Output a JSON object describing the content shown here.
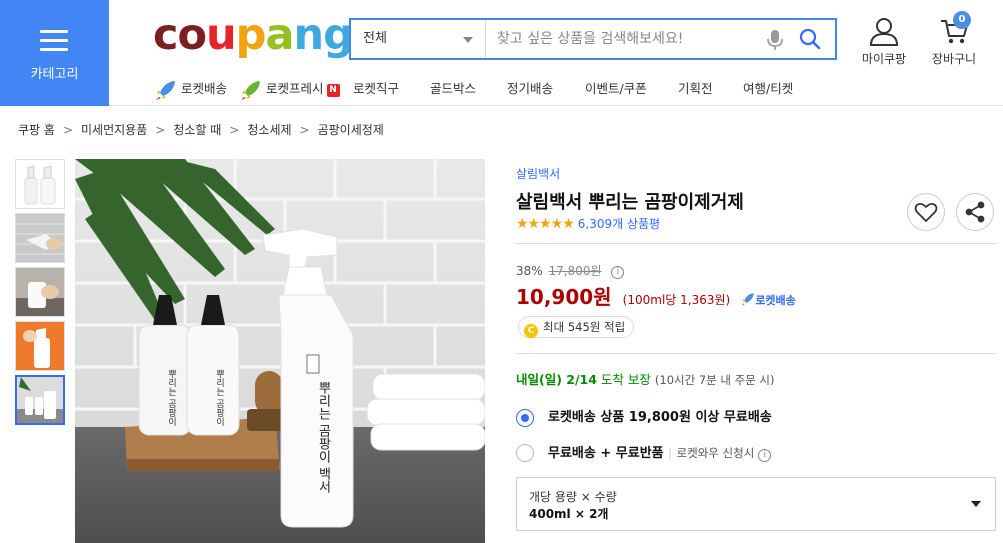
{
  "header": {
    "category_label": "카테고리",
    "logo": [
      {
        "ch": "c",
        "color": "#7b1e1e"
      },
      {
        "ch": "o",
        "color": "#7b1e1e"
      },
      {
        "ch": "u",
        "color": "#e52528"
      },
      {
        "ch": "p",
        "color": "#f2a30f"
      },
      {
        "ch": "a",
        "color": "#94c120"
      },
      {
        "ch": "n",
        "color": "#3fa9dd"
      },
      {
        "ch": "g",
        "color": "#3fa9dd"
      }
    ],
    "search": {
      "category_value": "전체",
      "placeholder": "찾고 싶은 상품을 검색해보세요!"
    },
    "mycoupang_label": "마이쿠팡",
    "cart_label": "장바구니",
    "cart_count": "0"
  },
  "nav": [
    {
      "label": "로켓배송",
      "icon": "rocket-icon"
    },
    {
      "label": "로켓프레시",
      "icon": "rocket-icon",
      "badge": "N"
    },
    {
      "label": "로켓직구"
    },
    {
      "label": "골드박스"
    },
    {
      "label": "정기배송"
    },
    {
      "label": "이벤트/쿠폰"
    },
    {
      "label": "기획전"
    },
    {
      "label": "여행/티켓"
    }
  ],
  "breadcrumb": [
    "쿠팡 홈",
    "미세먼지용품",
    "청소할 때",
    "청소세제",
    "곰팡이세정제"
  ],
  "product": {
    "brand": "살림백서",
    "title": "살림백서 뿌리는 곰팡이제거제",
    "rating": 4.5,
    "stars": "★★★★★",
    "review_count": "6,309개 상품평",
    "discount_rate": "38%",
    "original_price": "17,800원",
    "price": "10,900원",
    "unit_price": "(100ml당 1,363원)",
    "rocket_label": "로켓배송",
    "cash_label": "최대 545원 적립",
    "arrival_day": "내일(일) 2/14",
    "arrival_guarantee": " 도착 보장",
    "arrival_note": "(10시간 7분 내 주문 시)",
    "shipping_options": [
      {
        "label": "로켓배송 상품 19,800원 이상 무료배송",
        "selected": true
      },
      {
        "label": "무료배송 + 무료반품",
        "sub": "로켓와우 신청시",
        "selected": false
      }
    ],
    "option_select": {
      "label": "개당 용량 × 수량",
      "value": "400ml × 2개"
    },
    "bottle_label": "뿌리는 곰팡이 백서",
    "bottle_small_label": "뿌리는 곰팡이 백서"
  },
  "colors": {
    "accent": "#346aff",
    "price": "#ae0000",
    "category_bg": "#4285f4",
    "arrival": "#008c00",
    "star": "#f2a30f"
  }
}
